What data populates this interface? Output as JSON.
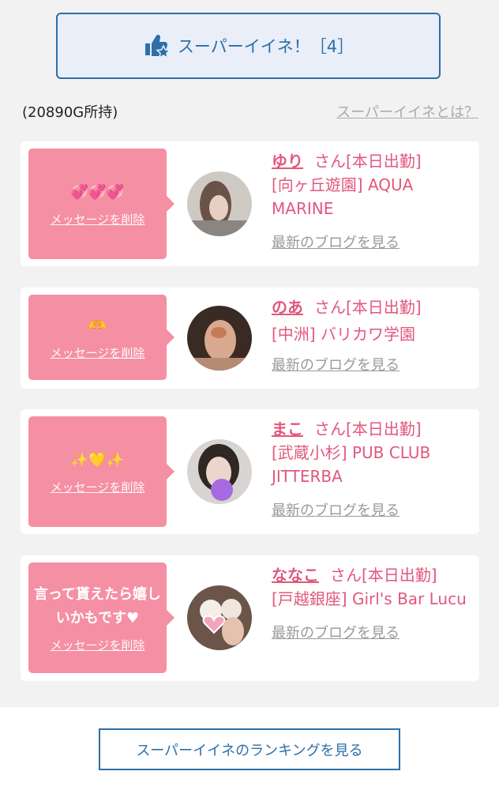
{
  "super_button": {
    "label": "スーパーイイネ！［4］"
  },
  "owned": "(20890G所持)",
  "about_link": "スーパーイイネとは？",
  "cards": [
    {
      "message": "💞💞💞",
      "delete": "メッセージを削除",
      "name": "ゆり",
      "san": "さん[本日出勤]",
      "shop": "[向ヶ丘遊園] AQUA MARINE",
      "blog": "最新のブログを見る"
    },
    {
      "message": "🫶",
      "delete": "メッセージを削除",
      "name": "のあ",
      "san": "さん[本日出勤]",
      "shop": "[中洲] バリカワ学園",
      "blog": "最新のブログを見る"
    },
    {
      "message": "✨💛✨",
      "delete": "メッセージを削除",
      "name": "まこ",
      "san": "さん[本日出勤]",
      "shop": "[武蔵小杉] PUB CLUB JITTERBA",
      "blog": "最新のブログを見る"
    },
    {
      "message": "言って貰えたら嬉しいかもです♥",
      "delete": "メッセージを削除",
      "name": "ななこ",
      "san": "さん[本日出勤]",
      "shop": "[戸越銀座] Girl's Bar Lucu",
      "blog": "最新のブログを見る"
    }
  ],
  "ranking_button": "スーパーイイネのランキングを見る",
  "colors": {
    "accent_blue": "#2d6fa8",
    "pink": "#f58fa3",
    "name_pink": "#e2577d"
  }
}
